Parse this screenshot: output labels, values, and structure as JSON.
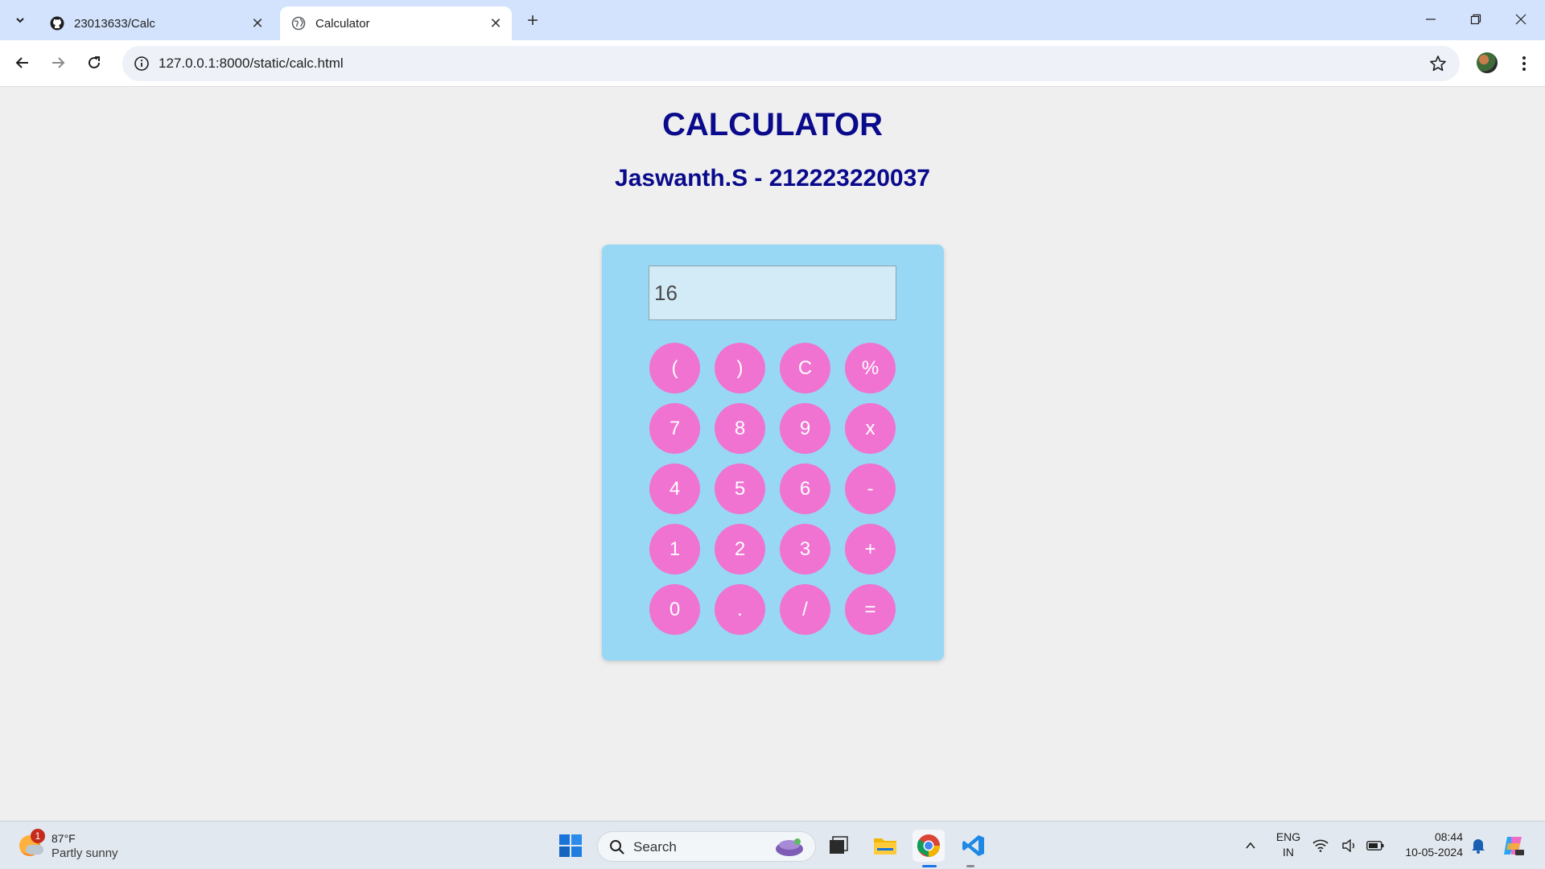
{
  "browser": {
    "tabs": [
      {
        "title": "23013633/Calc",
        "icon": "github-icon"
      },
      {
        "title": "Calculator",
        "icon": "globe-icon"
      }
    ],
    "url": "127.0.0.1:8000/static/calc.html"
  },
  "page": {
    "title": "CALCULATOR",
    "subtitle": "Jaswanth.S - 212223220037"
  },
  "calculator": {
    "display_value": "16",
    "keys": [
      "(",
      ")",
      "C",
      "%",
      "7",
      "8",
      "9",
      "x",
      "4",
      "5",
      "6",
      "-",
      "1",
      "2",
      "3",
      "+",
      "0",
      ".",
      "/",
      "="
    ],
    "colors": {
      "panel": "#98d8f4",
      "display": "#d3ebf7",
      "key": "#f073d2",
      "heading": "#0a0a8c"
    }
  },
  "taskbar": {
    "weather": {
      "temp": "87°F",
      "condition": "Partly sunny",
      "badge": "1"
    },
    "search_placeholder": "Search",
    "lang_top": "ENG",
    "lang_bottom": "IN",
    "time": "08:44",
    "date": "10-05-2024"
  }
}
